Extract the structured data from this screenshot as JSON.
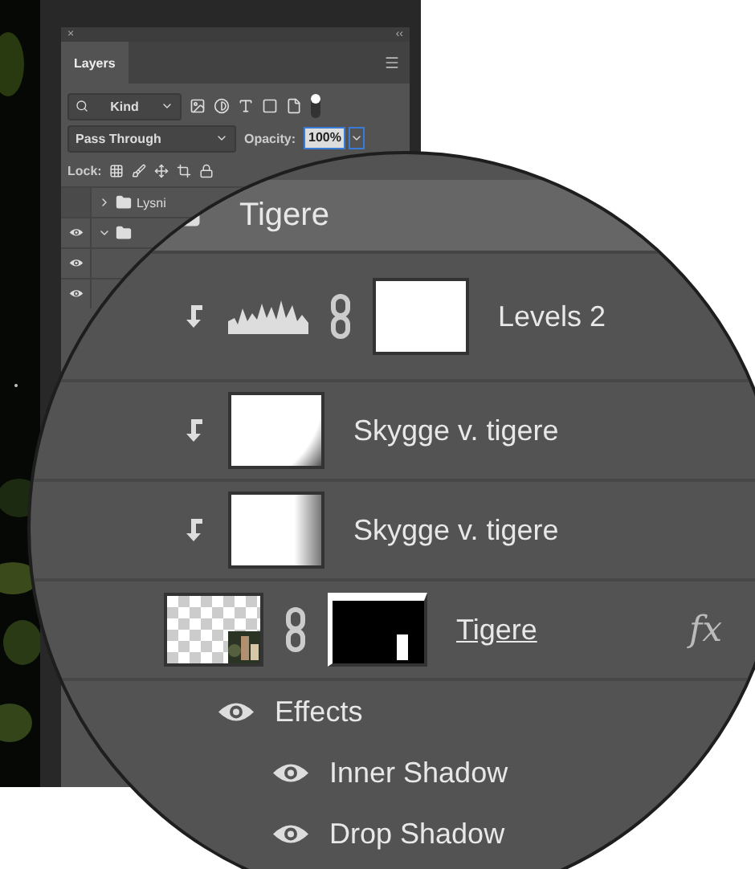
{
  "panel": {
    "close": "×",
    "collapse": "‹‹",
    "title": "Layers",
    "filter": "Kind",
    "blend_mode": "Pass Through",
    "opacity_label": "Opacity:",
    "opacity": "100%",
    "lock_label": "Lock:",
    "layers": [
      {
        "kind": "group",
        "name": "Lysni",
        "visible": false,
        "expanded": false
      },
      {
        "kind": "group",
        "visible": true,
        "expanded": true
      },
      {
        "kind": "layer",
        "visible": true
      },
      {
        "kind": "layer",
        "visible": true
      }
    ]
  },
  "magnifier": {
    "group": "Tigere",
    "layers": [
      {
        "kind": "adjustment",
        "name": "Levels 2",
        "clipped": true
      },
      {
        "kind": "shadow",
        "name": "Skygge v. tigere",
        "clipped": true
      },
      {
        "kind": "shadow-side",
        "name": "Skygge v. tigere",
        "clipped": true
      },
      {
        "kind": "masked",
        "name": "Tigere",
        "fx": "fx"
      }
    ],
    "effects_label": "Effects",
    "effects": [
      "Inner Shadow",
      "Drop Shadow"
    ]
  }
}
